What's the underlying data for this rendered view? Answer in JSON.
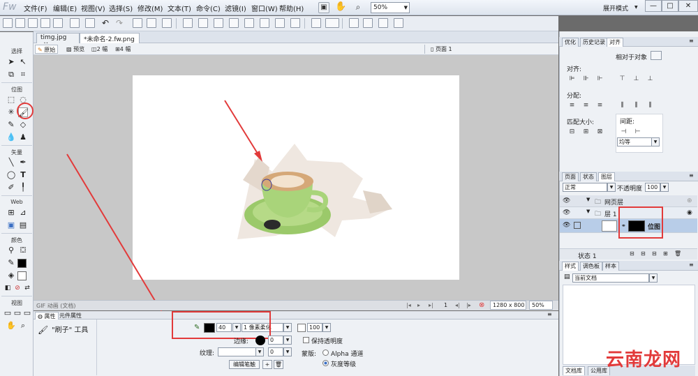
{
  "app": {
    "logo": "Fw"
  },
  "menu": [
    "文件(F)",
    "编辑(E)",
    "视图(V)",
    "选择(S)",
    "修改(M)",
    "文本(T)",
    "命令(C)",
    "滤镜(I)",
    "窗口(W)",
    "帮助(H)"
  ],
  "header": {
    "zoom": "50%",
    "workspace": "展开模式",
    "win_min": "—",
    "win_max": "□",
    "win_close": "✕"
  },
  "tools": {
    "sections": [
      "选择",
      "位图",
      "矢量",
      "Web",
      "颜色",
      "视图"
    ]
  },
  "doc_tabs": [
    {
      "label": "timg.jpg",
      "close": "×"
    },
    {
      "label": "*未命名-2.fw.png",
      "close": "×"
    }
  ],
  "view_tabs": {
    "original": "原始",
    "preview": "预览",
    "two_up": "2 幅",
    "four_up": "4 幅",
    "page": "页面 1"
  },
  "status": {
    "file_type": "GIF 动画 (文档)",
    "frame": "1",
    "size": "1280 x 800",
    "zoom": "50%"
  },
  "props": {
    "tabs": [
      "属性",
      "元件属性"
    ],
    "tool_name": "\"刷子\" 工具",
    "brush_size": "40",
    "brush_type": "1 像素柔化",
    "opacity": "100",
    "edge_label": "边缘:",
    "edge_value": "0",
    "texture_label": "纹理:",
    "texture_value": "0",
    "edit_stroke": "编辑笔触",
    "preserve_transparency": "保持透明度",
    "mask_label": "蒙版:",
    "mask_alpha": "Alpha 通道",
    "mask_gray": "灰度等级"
  },
  "right": {
    "tabs1": [
      "优化",
      "历史记录",
      "对齐"
    ],
    "relative": "相对于对象",
    "align": "对齐:",
    "distribute": "分配:",
    "match_size": "匹配大小:",
    "spacing": "间距:",
    "spacing_select": "均等",
    "tabs2": [
      "页面",
      "状态",
      "图层"
    ],
    "blend_mode": "正常",
    "opacity_label": "不透明度",
    "opacity_value": "100",
    "layers": [
      {
        "name": "网页层"
      },
      {
        "name": "层 1"
      },
      {
        "name": "位图"
      }
    ],
    "state": "状态 1",
    "tabs3": [
      "样式",
      "调色板",
      "样本"
    ],
    "styles_select": "当前文档",
    "bottom_tabs": [
      "文档库",
      "公用库"
    ]
  },
  "watermark": "云南龙网",
  "colors": {
    "accent_red": "#e23a3a",
    "selected_layer": "#b8cde8"
  }
}
